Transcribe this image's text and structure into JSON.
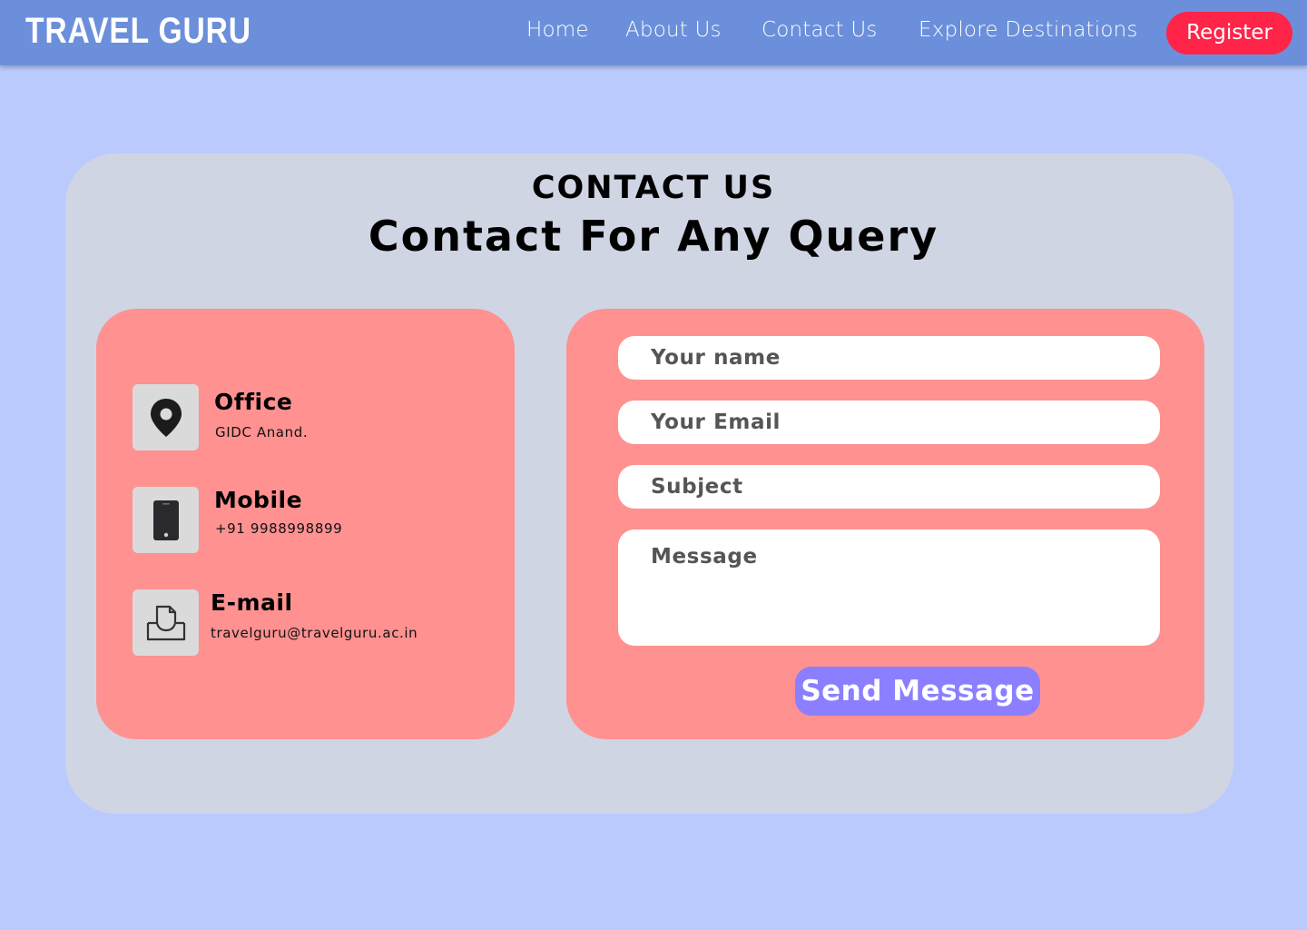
{
  "nav": {
    "brand": "TRAVEL GURU",
    "links": [
      "Home",
      "About Us",
      "Contact Us",
      "Explore Destinations"
    ],
    "register_label": "Register"
  },
  "header": {
    "eyebrow": "CONTACT US",
    "title": "Contact For Any Query"
  },
  "info": {
    "office": {
      "title": "Office",
      "text": "GIDC Anand.",
      "icon": "location-pin-icon"
    },
    "mobile": {
      "title": "Mobile",
      "text": "+91 9988998899",
      "icon": "mobile-phone-icon"
    },
    "email": {
      "title": "E-mail",
      "text": "travelguru@travelguru.ac.in",
      "icon": "inbox-icon"
    }
  },
  "form": {
    "name_placeholder": "Your name",
    "email_placeholder": "Your Email",
    "subject_placeholder": "Subject",
    "message_placeholder": "Message",
    "send_label": "Send Message"
  },
  "colors": {
    "page_bg": "#bbcafd",
    "navbar": "#6b8fda",
    "register": "#ff2448",
    "card_bg": "#d0d5e3",
    "panel": "#ff9191",
    "send": "#8b7fff"
  }
}
